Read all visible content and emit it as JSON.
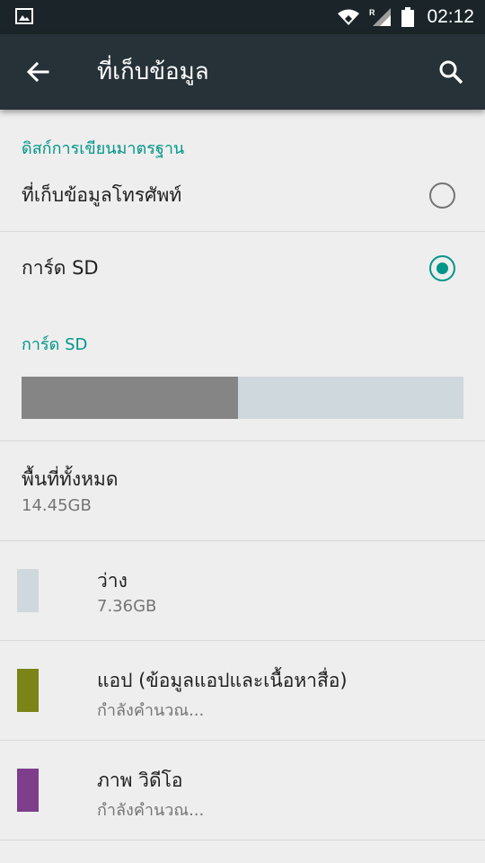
{
  "status_bar": {
    "time": "02:12",
    "icons": [
      "image-icon",
      "wifi-icon",
      "roaming-signal-icon",
      "battery-icon"
    ]
  },
  "app_bar": {
    "title": "ที่เก็บข้อมูล",
    "back_icon": "arrow-back-icon",
    "search_icon": "search-icon"
  },
  "default_disk": {
    "header": "ดิสก์การเขียนมาตรฐาน",
    "options": [
      {
        "label": "ที่เก็บข้อมูลโทรศัพท์",
        "selected": false
      },
      {
        "label": "การ์ด SD",
        "selected": true
      }
    ]
  },
  "sd_card": {
    "header": "การ์ด SD",
    "used_fraction": 0.49,
    "total": {
      "label": "พื้นที่ทั้งหมด",
      "value": "14.45GB"
    },
    "categories": [
      {
        "name": "ว่าง",
        "value": "7.36GB",
        "color": "#cfd8dc"
      },
      {
        "name": "แอป (ข้อมูลแอปและเนื้อหาสื่อ)",
        "value": "กำลังคำนวณ...",
        "color": "#7b8417"
      },
      {
        "name": "ภาพ วิดีโอ",
        "value": "กำลังคำนวณ...",
        "color": "#7e3e8c"
      }
    ]
  },
  "colors": {
    "status_bar": "#1b2428",
    "app_bar": "#263238",
    "accent": "#009688",
    "background": "#eeeeee"
  }
}
